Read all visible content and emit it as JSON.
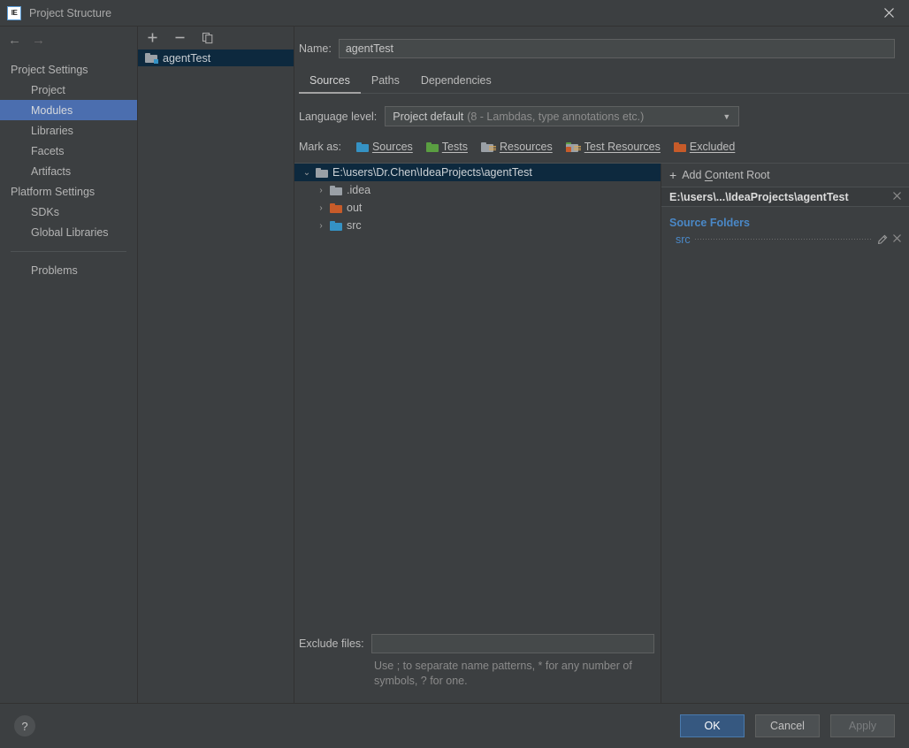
{
  "window": {
    "title": "Project Structure",
    "app_icon": "IE",
    "close_icon": "close-icon"
  },
  "sidebar": {
    "nav": {
      "back_icon": "arrow-left-icon",
      "forward_icon": "arrow-right-icon"
    },
    "groups": [
      {
        "label": "Project Settings",
        "items": [
          {
            "label": "Project",
            "selected": false
          },
          {
            "label": "Modules",
            "selected": true
          },
          {
            "label": "Libraries",
            "selected": false
          },
          {
            "label": "Facets",
            "selected": false
          },
          {
            "label": "Artifacts",
            "selected": false
          }
        ]
      },
      {
        "label": "Platform Settings",
        "items": [
          {
            "label": "SDKs",
            "selected": false
          },
          {
            "label": "Global Libraries",
            "selected": false
          }
        ]
      }
    ],
    "extra_items": [
      {
        "label": "Problems",
        "selected": false
      }
    ]
  },
  "modules_panel": {
    "toolbar": [
      {
        "icon": "plus-icon",
        "glyph": "+"
      },
      {
        "icon": "minus-icon",
        "glyph": "−"
      },
      {
        "icon": "copy-icon",
        "glyph": "❐"
      }
    ],
    "modules": [
      {
        "label": "agentTest",
        "selected": true,
        "icon": "module-folder-icon"
      }
    ]
  },
  "main": {
    "name_label": "Name:",
    "name_value": "agentTest",
    "tabs": [
      {
        "label": "Sources",
        "active": true
      },
      {
        "label": "Paths",
        "active": false
      },
      {
        "label": "Dependencies",
        "active": false
      }
    ],
    "language_level": {
      "label": "Language level:",
      "value": "Project default",
      "detail": "(8 - Lambdas, type annotations etc.)",
      "caret_icon": "chevron-down-icon"
    },
    "mark_as": {
      "label": "Mark as:",
      "options": [
        {
          "label": "Sources",
          "color": "#3592c4",
          "kind": "folder"
        },
        {
          "label": "Tests",
          "color": "#5a9e41",
          "kind": "folder"
        },
        {
          "label": "Resources",
          "color": "#9aa0a6",
          "kind": "folder-lines"
        },
        {
          "label": "Test Resources",
          "color": "#9aa0a6",
          "kind": "folder-lines"
        },
        {
          "label": "Excluded",
          "color": "#c75b29",
          "kind": "folder"
        }
      ]
    },
    "tree": [
      {
        "label": "E:\\users\\Dr.Chen\\IdeaProjects\\agentTest",
        "depth": 0,
        "expanded": true,
        "selected": true,
        "twisty": "⌄",
        "folder_color": "#9aa0a6"
      },
      {
        "label": ".idea",
        "depth": 1,
        "expanded": false,
        "selected": false,
        "twisty": "›",
        "folder_color": "#9aa0a6"
      },
      {
        "label": "out",
        "depth": 1,
        "expanded": false,
        "selected": false,
        "twisty": "›",
        "folder_color": "#c75b29"
      },
      {
        "label": "src",
        "depth": 1,
        "expanded": false,
        "selected": false,
        "twisty": "›",
        "folder_color": "#3592c4"
      }
    ],
    "exclude": {
      "label": "Exclude files:",
      "value": "",
      "hint": "Use ; to separate name patterns, * for any number of symbols, ? for one."
    }
  },
  "detail": {
    "add_content_root": {
      "plus": "+",
      "prefix": "Add ",
      "underlined": "C",
      "suffix": "ontent Root"
    },
    "content_root": {
      "path": "E:\\users\\...\\IdeaProjects\\agentTest",
      "remove_icon": "close-icon"
    },
    "source_folders": {
      "title": "Source Folders",
      "entries": [
        {
          "name": "src",
          "edit_icon": "pencil-icon",
          "remove_icon": "close-icon"
        }
      ]
    }
  },
  "footer": {
    "help_icon": "question-mark-icon",
    "buttons": [
      {
        "label": "OK",
        "style": "primary"
      },
      {
        "label": "Cancel",
        "style": "normal"
      },
      {
        "label": "Apply",
        "style": "disabled"
      }
    ]
  }
}
